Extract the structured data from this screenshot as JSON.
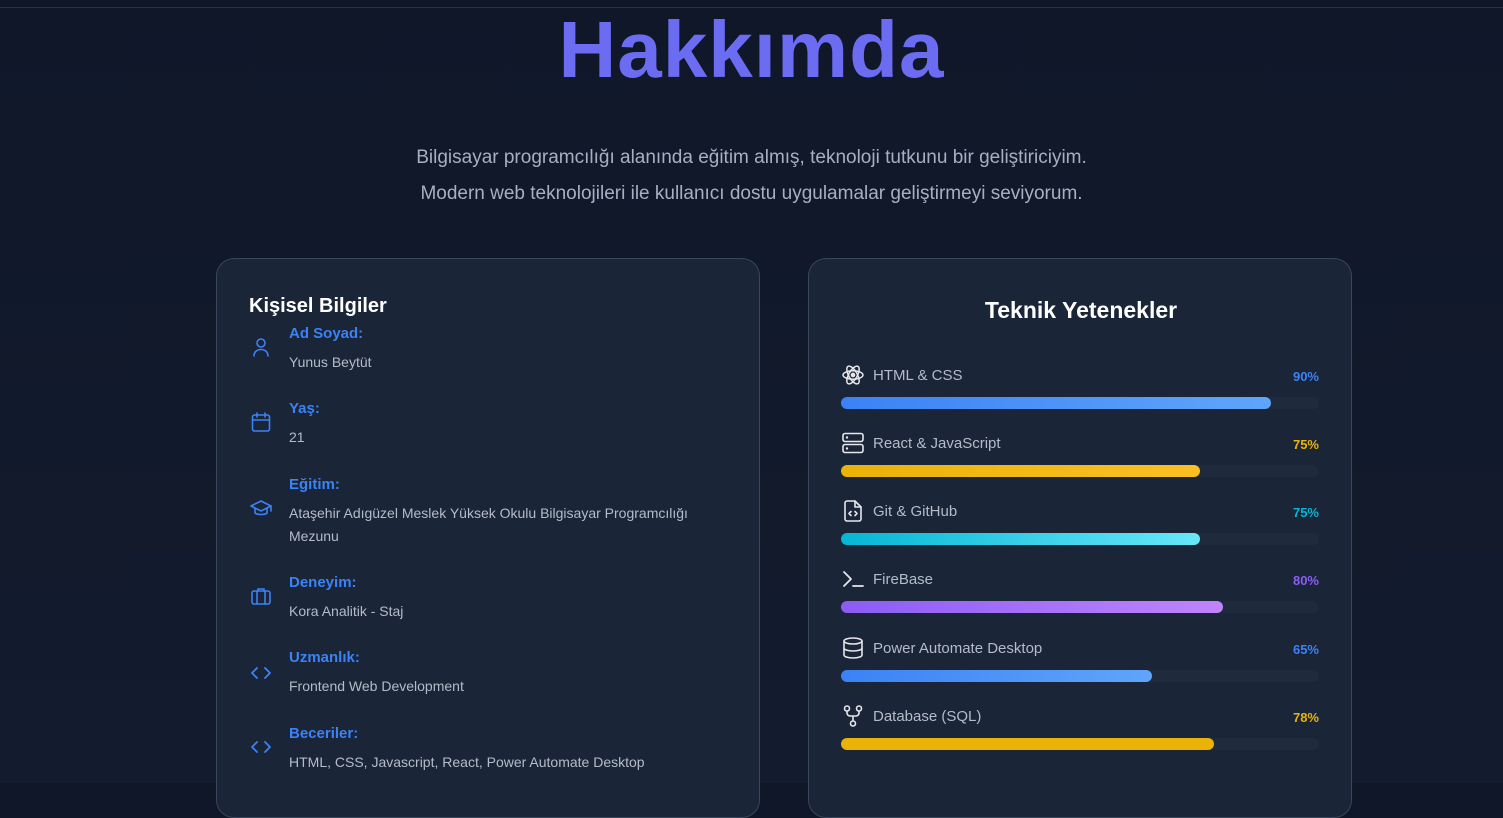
{
  "page": {
    "title": "Hakkımda",
    "intro_line1": "Bilgisayar programcılığı alanında eğitim almış, teknoloji tutkunu bir geliştiriciyim.",
    "intro_line2": "Modern web teknolojileri ile kullanıcı dostu uygulamalar geliştirmeyi seviyorum."
  },
  "personal": {
    "title": "Kişisel Bilgiler",
    "items": [
      {
        "label": "Ad Soyad:",
        "value": "Yunus Beytüt",
        "icon": "user-icon"
      },
      {
        "label": "Yaş:",
        "value": "21",
        "icon": "calendar-icon"
      },
      {
        "label": "Eğitim:",
        "value": "Ataşehir Adıgüzel Meslek Yüksek Okulu Bilgisayar Programcılığı Mezunu",
        "icon": "graduation-cap-icon"
      },
      {
        "label": "Deneyim:",
        "value": "Kora Analitik - Staj",
        "icon": "briefcase-icon"
      },
      {
        "label": "Uzmanlık:",
        "value": "Frontend Web Development",
        "icon": "code-icon"
      },
      {
        "label": "Beceriler:",
        "value": "HTML, CSS, Javascript, React, Power Automate Desktop",
        "icon": "code-icon"
      }
    ]
  },
  "skills": {
    "title": "Teknik Yetenekler",
    "items": [
      {
        "name": "HTML & CSS",
        "percent_label": "90%",
        "level": 0.9,
        "icon": "atom-icon",
        "color": "#3b82f6",
        "color2": "#60a5fa",
        "pct_color": "#3b82f6"
      },
      {
        "name": "React & JavaScript",
        "percent_label": "75%",
        "level": 0.75,
        "icon": "server-icon",
        "color": "#eab308",
        "color2": "#fbbf24",
        "pct_color": "#eab308"
      },
      {
        "name": "Git & GitHub",
        "percent_label": "75%",
        "level": 0.75,
        "icon": "file-code-icon",
        "color": "#06b6d4",
        "color2": "#67e8f9",
        "pct_color": "#06b6d4"
      },
      {
        "name": "FireBase",
        "percent_label": "80%",
        "level": 0.8,
        "icon": "terminal-icon",
        "color": "#8b5cf6",
        "color2": "#c084fc",
        "pct_color": "#8b5cf6"
      },
      {
        "name": "Power Automate Desktop",
        "percent_label": "65%",
        "level": 0.65,
        "icon": "database-icon",
        "color": "#3b82f6",
        "color2": "#60a5fa",
        "pct_color": "#3b82f6"
      },
      {
        "name": "Database (SQL)",
        "percent_label": "78%",
        "level": 0.78,
        "icon": "git-fork-icon",
        "color": "#eab308",
        "color2": "#eab308",
        "pct_color": "#eab308"
      }
    ]
  }
}
